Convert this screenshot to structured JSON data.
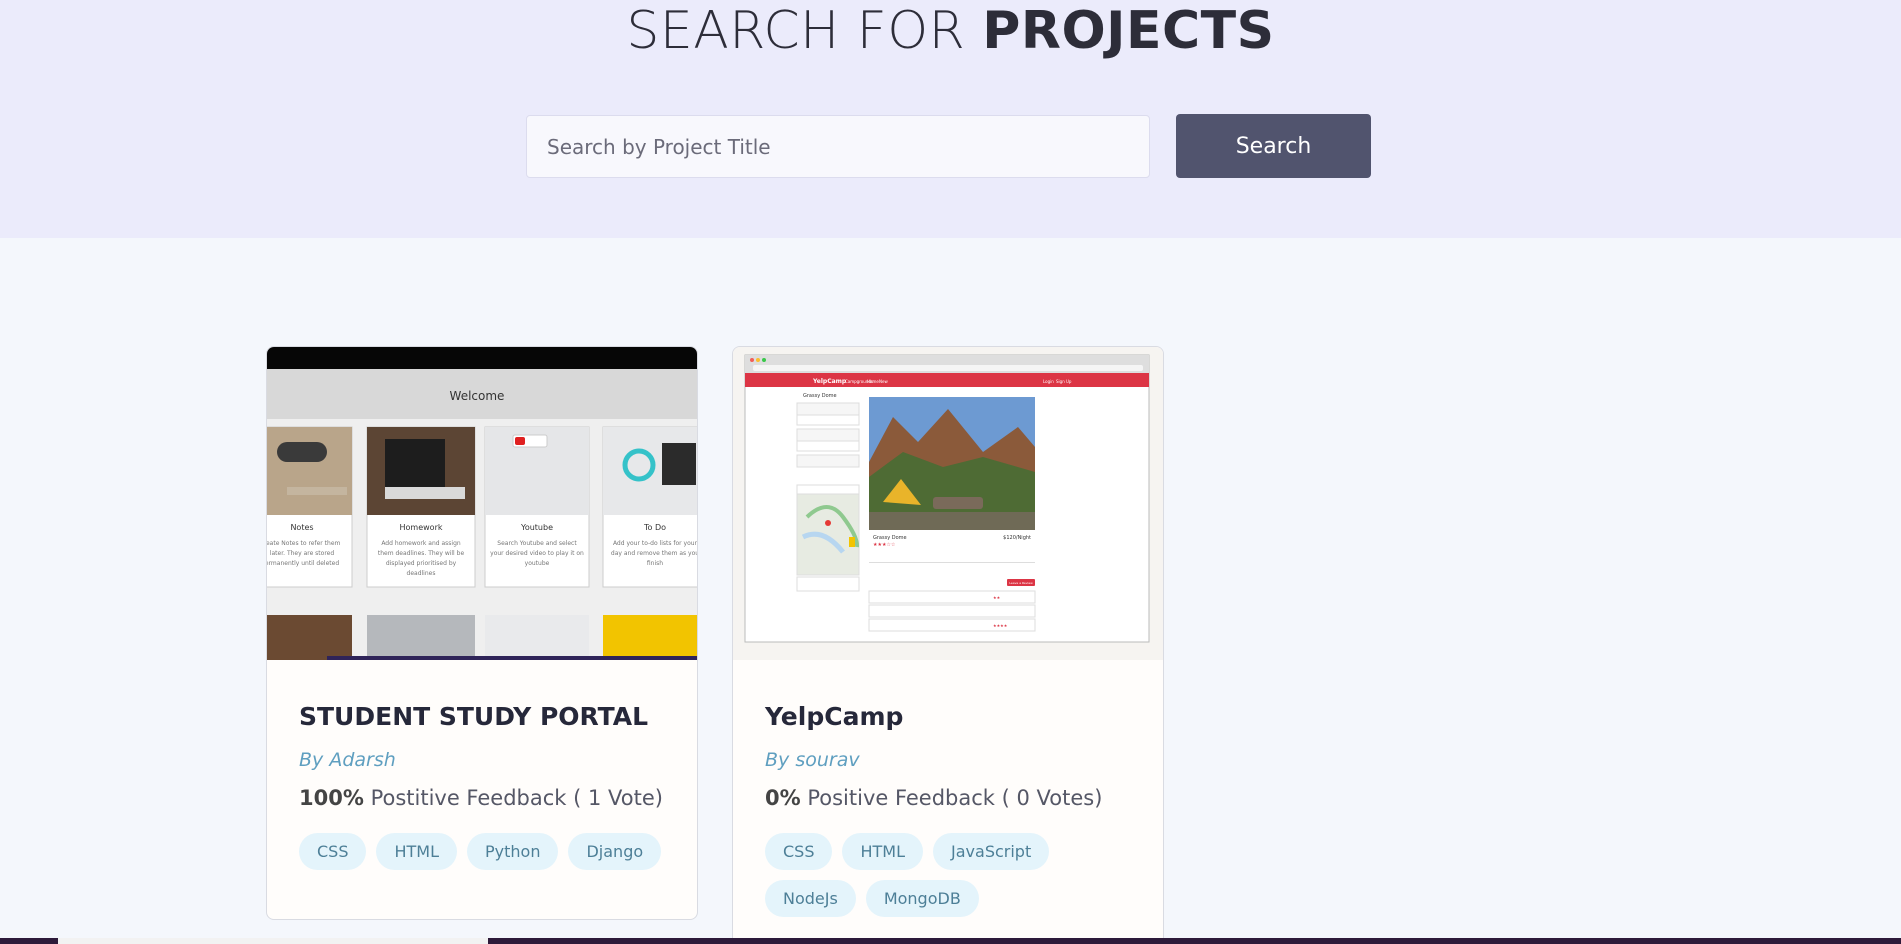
{
  "hero": {
    "title_light": "SEARCH FOR ",
    "title_bold": "PROJECTS",
    "search_placeholder": "Search by Project Title",
    "search_label": "Search"
  },
  "projects": [
    {
      "title": "STUDENT STUDY PORTAL",
      "author": "By Adarsh",
      "feedback_pct": "100%",
      "feedback_text": " Postitive Feedback ( 1 Vote)",
      "tags": [
        "CSS",
        "HTML",
        "Python",
        "Django"
      ],
      "thumb": {
        "heading": "Welcome",
        "tiles": [
          {
            "title": "Notes",
            "text": "reate Notes to refer them later. They are stored ermanently until deleted"
          },
          {
            "title": "Homework",
            "text": "Add homework and assign them deadlines. They will be displayed prioritised by deadlines"
          },
          {
            "title": "Youtube",
            "text": "Search Youtube and select your desired video to play it on youtube"
          },
          {
            "title": "To Do",
            "text": "Add your to-do lists for your day and remove them as you finish"
          }
        ]
      }
    },
    {
      "title": "YelpCamp",
      "author": "By sourav",
      "feedback_pct": "0%",
      "feedback_text": " Positive Feedback ( 0 Votes)",
      "tags": [
        "CSS",
        "HTML",
        "JavaScript",
        "NodeJs",
        "MongoDB"
      ],
      "thumb": {
        "brand": "YelpCamp",
        "nav": [
          "Campgrounds",
          "Home",
          "New"
        ],
        "auth": [
          "Login",
          "Sign Up"
        ],
        "camp_name": "Grassy Dome",
        "price": "$120/Night",
        "review_button": "Leave a Review",
        "owner": "Grassy Dome"
      }
    }
  ],
  "colors": {
    "hero_bg": "#ebebfb",
    "button_bg": "#51546e",
    "tag_bg": "#e4f4fb",
    "author": "#5f9fc0",
    "yelp_red": "#dc3545"
  }
}
